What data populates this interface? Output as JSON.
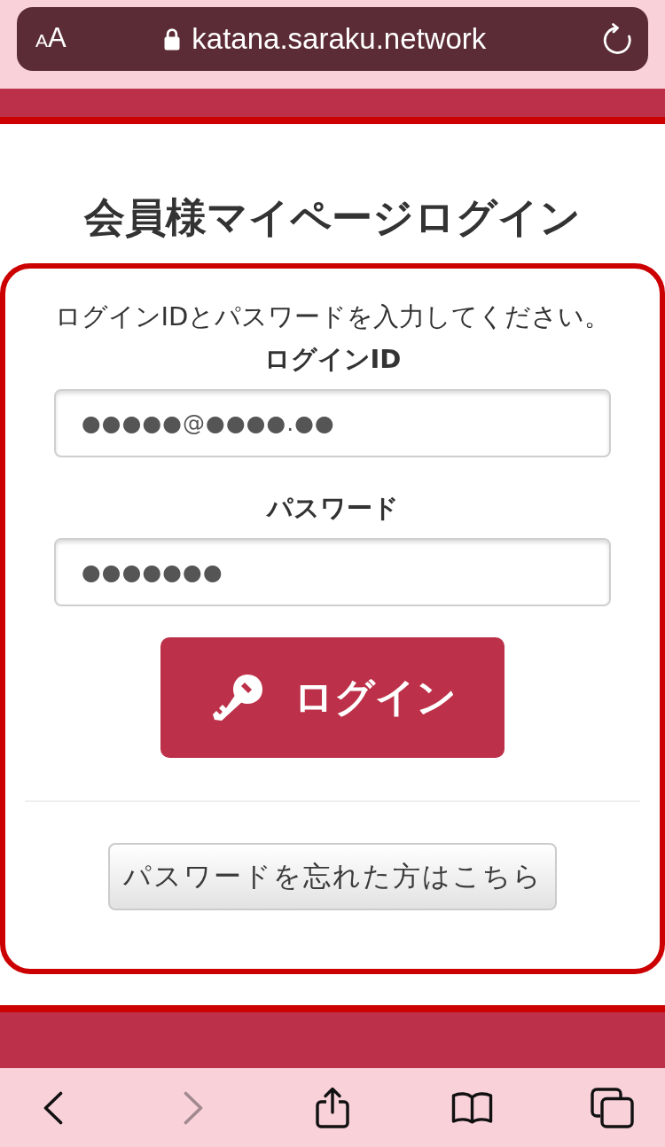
{
  "browser": {
    "text_size_button": "AA",
    "url": "katana.saraku.network"
  },
  "page": {
    "title": "会員様マイページログイン"
  },
  "login_form": {
    "instruction": "ログインIDとパスワードを入力してください。",
    "fields": [
      {
        "label": "ログインID",
        "value": "●●●●●@●●●●.●●"
      },
      {
        "label": "パスワード",
        "value": "●●●●●●●"
      }
    ],
    "login_button": "ログイン",
    "forgot_password_button": "パスワードを忘れた方はこちら"
  },
  "toolbar": [
    {
      "kind": "back",
      "disabled": false
    },
    {
      "kind": "forward",
      "disabled": true
    },
    {
      "kind": "share",
      "disabled": false
    },
    {
      "kind": "bookmarks",
      "disabled": false
    },
    {
      "kind": "tabs",
      "disabled": false
    }
  ]
}
